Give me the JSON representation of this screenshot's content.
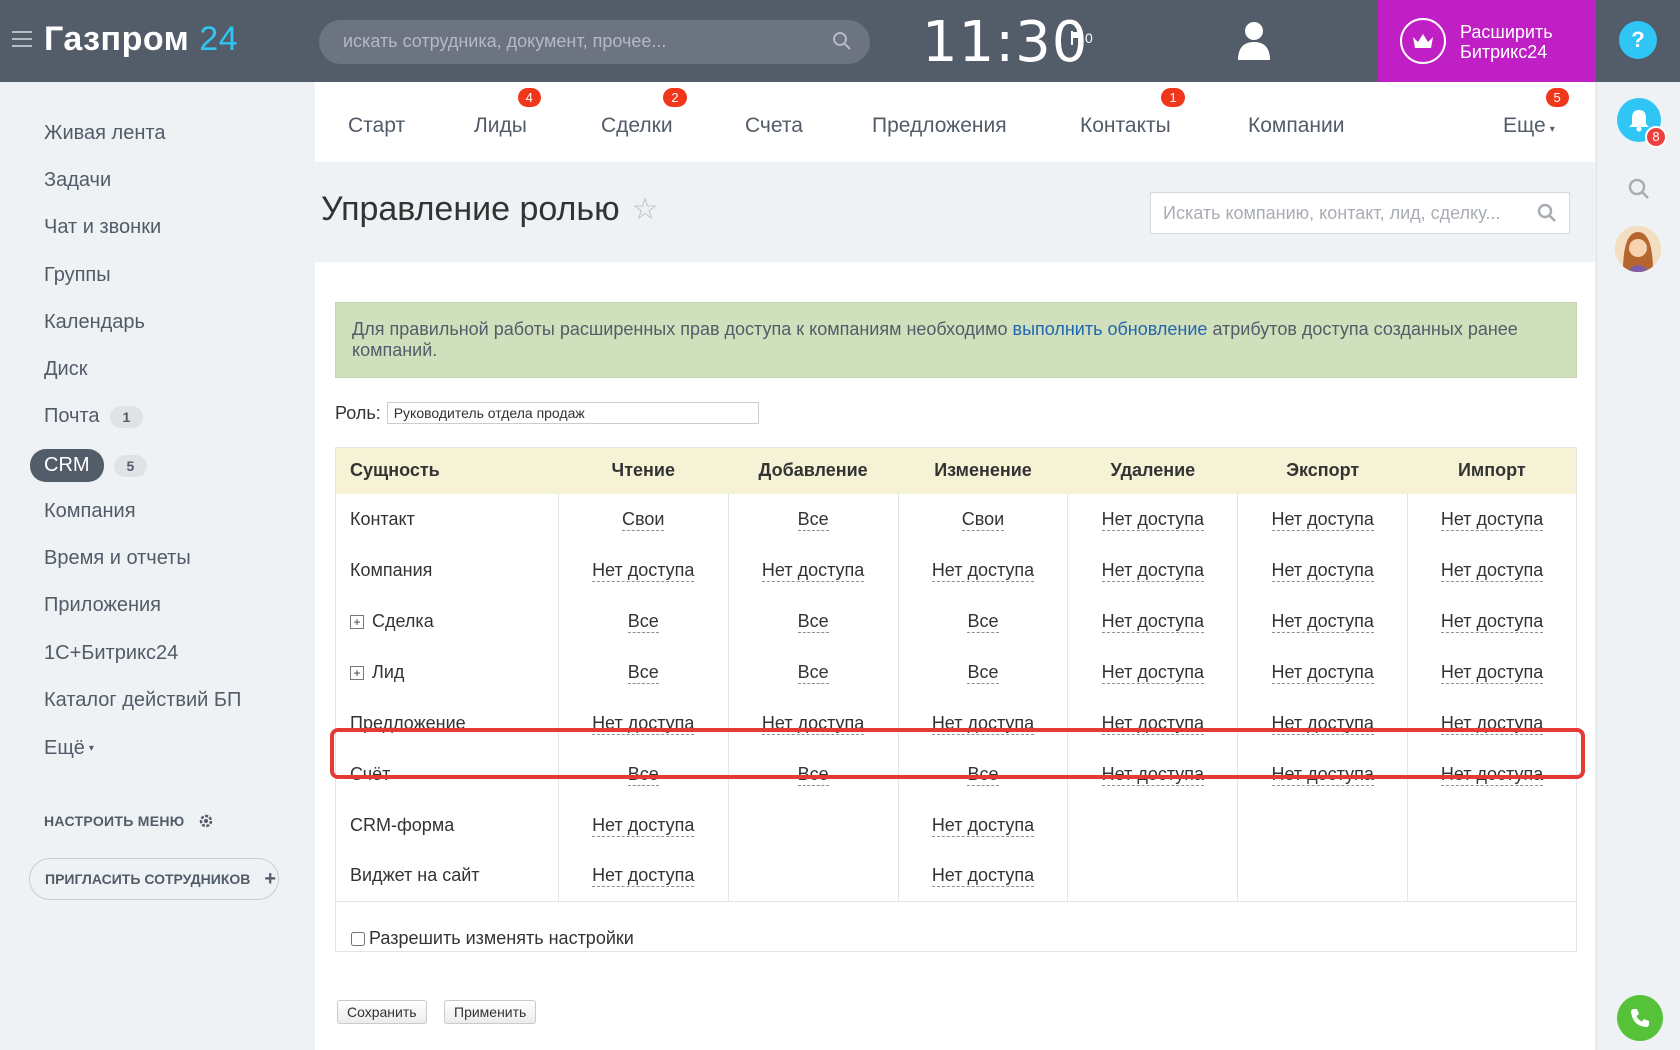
{
  "topbar": {
    "logo_name": "Газпром",
    "logo_num": "24",
    "search_placeholder": "искать сотрудника, документ, прочее...",
    "time": "11:30",
    "flag_count": "0",
    "upgrade_line1": "Расширить",
    "upgrade_line2": "Битрикс24",
    "help": "?"
  },
  "sidebar": {
    "items": [
      {
        "label": "Живая лента"
      },
      {
        "label": "Задачи"
      },
      {
        "label": "Чат и звонки"
      },
      {
        "label": "Группы"
      },
      {
        "label": "Календарь"
      },
      {
        "label": "Диск"
      },
      {
        "label": "Почта",
        "count": "1"
      },
      {
        "label": "CRM",
        "count": "5"
      },
      {
        "label": "Компания"
      },
      {
        "label": "Время и отчеты"
      },
      {
        "label": "Приложения"
      },
      {
        "label": "1С+Битрикс24"
      },
      {
        "label": "Каталог действий БП"
      },
      {
        "label": "Ещё"
      }
    ],
    "configure_menu": "НАСТРОИТЬ МЕНЮ",
    "invite": "ПРИГЛАСИТЬ СОТРУДНИКОВ"
  },
  "rightbar": {
    "notifications_count": "8"
  },
  "tabs": [
    {
      "label": "Старт"
    },
    {
      "label": "Лиды",
      "badge": "4"
    },
    {
      "label": "Сделки",
      "badge": "2"
    },
    {
      "label": "Счета"
    },
    {
      "label": "Предложения"
    },
    {
      "label": "Контакты",
      "badge": "1"
    },
    {
      "label": "Компании"
    },
    {
      "label": "Еще",
      "badge": "5"
    }
  ],
  "page": {
    "title": "Управление ролью",
    "filter_placeholder": "Искать компанию, контакт, лид, сделку..."
  },
  "notice": {
    "before": "Для правильной работы расширенных прав доступа к компаниям необходимо ",
    "link": "выполнить обновление",
    "after": " атрибутов доступа созданных ранее компаний."
  },
  "role": {
    "label": "Роль:",
    "value": "Руководитель отдела продаж"
  },
  "table": {
    "headers": [
      "Сущность",
      "Чтение",
      "Добавление",
      "Изменение",
      "Удаление",
      "Экспорт",
      "Импорт"
    ],
    "rows": [
      {
        "entity": "Контакт",
        "cells": [
          "Свои",
          "Все",
          "Свои",
          "Нет доступа",
          "Нет доступа",
          "Нет доступа"
        ]
      },
      {
        "entity": "Компания",
        "cells": [
          "Нет доступа",
          "Нет доступа",
          "Нет доступа",
          "Нет доступа",
          "Нет доступа",
          "Нет доступа"
        ]
      },
      {
        "entity": "Сделка",
        "cells": [
          "Все",
          "Все",
          "Все",
          "Нет доступа",
          "Нет доступа",
          "Нет доступа"
        ]
      },
      {
        "entity": "Лид",
        "cells": [
          "Все",
          "Все",
          "Все",
          "Нет доступа",
          "Нет доступа",
          "Нет доступа"
        ]
      },
      {
        "entity": "Предложение",
        "cells": [
          "Нет доступа",
          "Нет доступа",
          "Нет доступа",
          "Нет доступа",
          "Нет доступа",
          "Нет доступа"
        ]
      },
      {
        "entity": "Счёт",
        "cells": [
          "Все",
          "Все",
          "Все",
          "Нет доступа",
          "Нет доступа",
          "Нет доступа"
        ]
      },
      {
        "entity": "CRM-форма",
        "cells": [
          "Нет доступа",
          "",
          "Нет доступа",
          "",
          "",
          ""
        ]
      },
      {
        "entity": "Виджет на сайт",
        "cells": [
          "Нет доступа",
          "",
          "Нет доступа",
          "",
          "",
          ""
        ]
      }
    ],
    "allow_edit": "Разрешить изменять настройки"
  },
  "buttons": {
    "save": "Сохранить",
    "apply": "Применить"
  }
}
